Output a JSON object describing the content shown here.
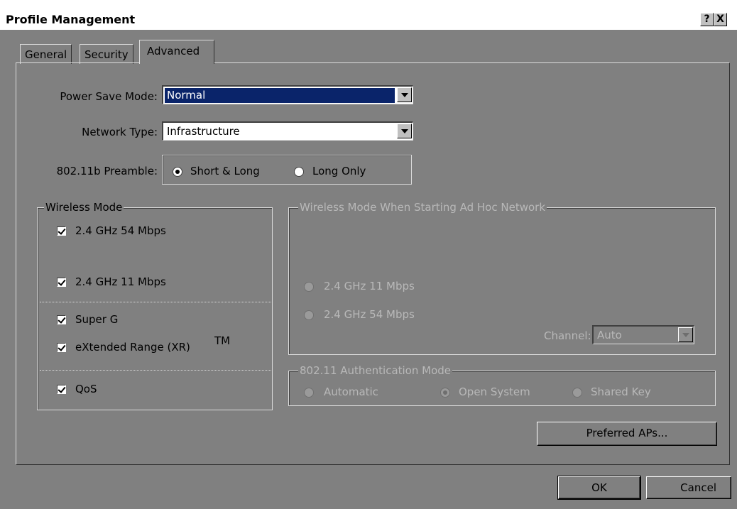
{
  "window": {
    "title": "Profile Management",
    "help_label": "?",
    "close_label": "X"
  },
  "tabs": [
    {
      "label": "General"
    },
    {
      "label": "Security"
    },
    {
      "label": "Advanced"
    }
  ],
  "power_save": {
    "label": "Power Save Mode:",
    "value": "Normal"
  },
  "network_type": {
    "label": "Network Type:",
    "value": "Infrastructure"
  },
  "preamble": {
    "label": "802.11b Preamble:",
    "options": [
      {
        "label": "Short & Long",
        "selected": true
      },
      {
        "label": "Long Only",
        "selected": false
      }
    ]
  },
  "wireless_mode": {
    "legend": "Wireless Mode",
    "options": [
      {
        "label": "2.4 GHz 54 Mbps",
        "checked": true
      },
      {
        "label": "2.4 GHz 11 Mbps",
        "checked": true
      },
      {
        "label": "Super G",
        "checked": true
      },
      {
        "label": "eXtended Range (XR)",
        "checked": true
      },
      {
        "label": "QoS",
        "checked": true
      }
    ],
    "tm": "TM"
  },
  "adhoc_mode": {
    "legend": "Wireless Mode When Starting Ad Hoc Network",
    "options": [
      {
        "label": "2.4 GHz 11 Mbps",
        "selected": false
      },
      {
        "label": "2.4 GHz 54 Mbps",
        "selected": false
      }
    ],
    "channel_label": "Channel:",
    "channel_value": "Auto"
  },
  "auth_mode": {
    "legend": "802.11 Authentication Mode",
    "options": [
      {
        "label": "Automatic",
        "selected": false
      },
      {
        "label": "Open System",
        "selected": true
      },
      {
        "label": "Shared Key",
        "selected": false
      }
    ]
  },
  "buttons": {
    "preferred_aps": "Preferred APs...",
    "ok": "OK",
    "cancel": "Cancel"
  }
}
